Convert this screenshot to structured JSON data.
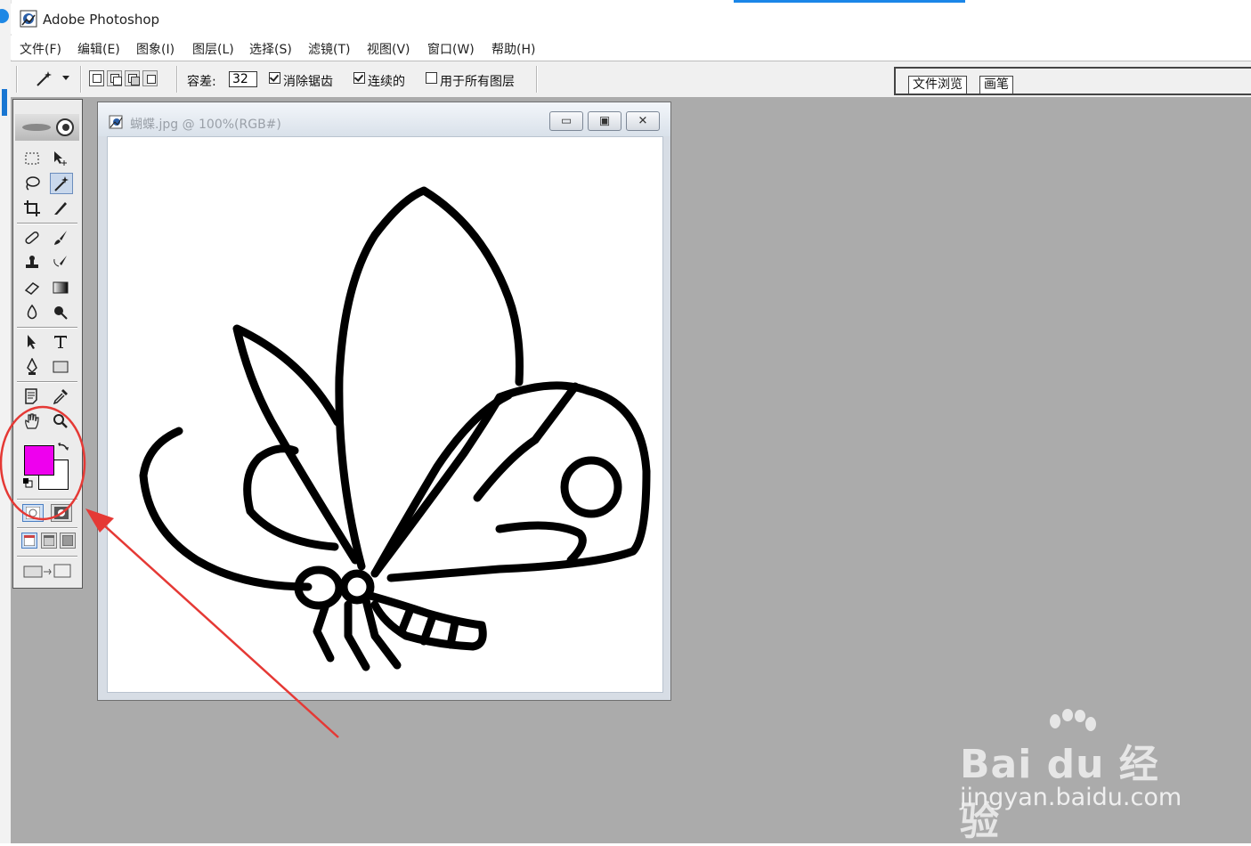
{
  "app": {
    "title": "Adobe Photoshop"
  },
  "menu": {
    "items": [
      "文件(F)",
      "编辑(E)",
      "图象(I)",
      "图层(L)",
      "选择(S)",
      "滤镜(T)",
      "视图(V)",
      "窗口(W)",
      "帮助(H)"
    ]
  },
  "options": {
    "tolerance_label": "容差:",
    "tolerance_value": "32",
    "antialias_label": "消除锯齿",
    "contiguous_label": "连续的",
    "all_layers_label": "用于所有图层",
    "antialias_checked": true,
    "contiguous_checked": true,
    "all_layers_checked": false
  },
  "palette_well": {
    "tabs": [
      "文件浏览",
      "画笔"
    ]
  },
  "document": {
    "title": "蝴蝶.jpg @ 100%(RGB#)"
  },
  "colors": {
    "foreground": "#ee00ee",
    "background": "#ffffff",
    "annotation": "#e53935",
    "workspace": "#ababab"
  },
  "toolbox": {
    "tools": [
      "marquee-icon",
      "move-icon",
      "lasso-icon",
      "magic-wand-icon",
      "crop-icon",
      "slice-icon",
      "healing-brush-icon",
      "brush-icon",
      "clone-stamp-icon",
      "history-brush-icon",
      "eraser-icon",
      "gradient-icon",
      "blur-icon",
      "dodge-icon",
      "path-select-icon",
      "type-icon",
      "pen-icon",
      "shape-icon",
      "notes-icon",
      "eyedropper-icon",
      "hand-icon",
      "zoom-icon"
    ],
    "active_tool": "magic-wand-icon"
  },
  "watermark": {
    "brand": "Bai du 经验",
    "url": "jingyan.baidu.com"
  }
}
